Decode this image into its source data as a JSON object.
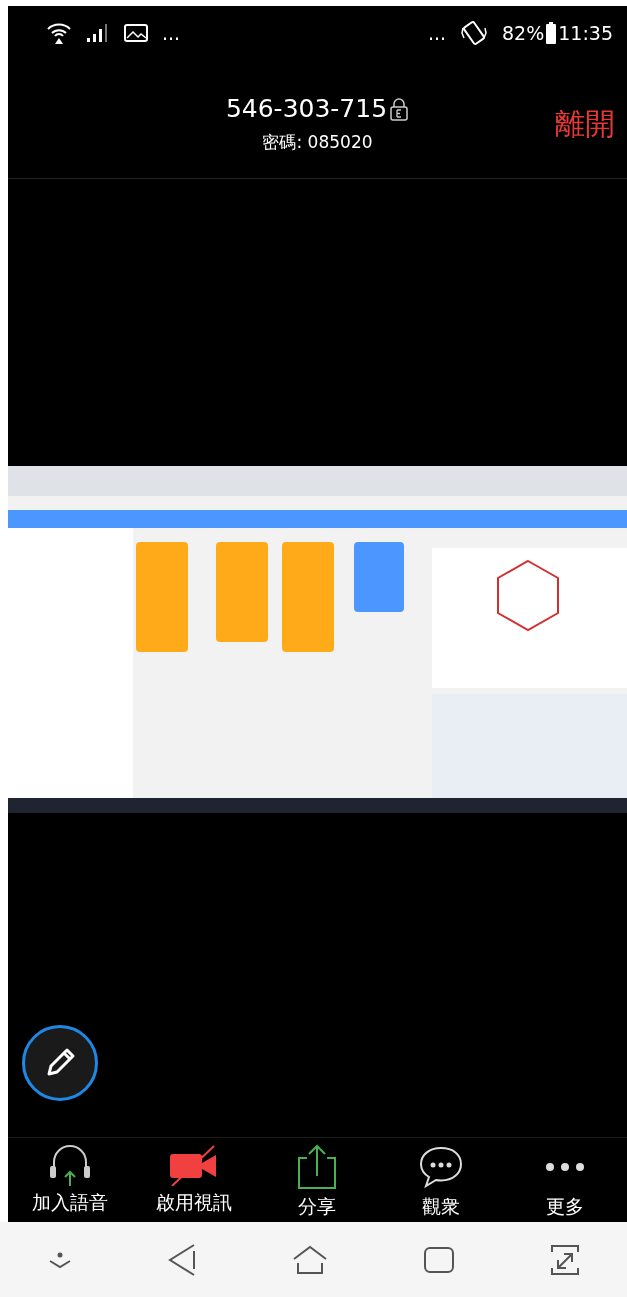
{
  "status_bar": {
    "left_more": "...",
    "right_more": "...",
    "battery": "82%",
    "time": "11:35"
  },
  "meeting": {
    "id": "546-303-715",
    "password": "密碼: 085020",
    "leave": "離開"
  },
  "toolbar": [
    {
      "kind": "audio",
      "label": "加入語音"
    },
    {
      "kind": "video",
      "label": "啟用視訊"
    },
    {
      "kind": "share",
      "label": "分享"
    },
    {
      "kind": "participants",
      "label": "觀衆"
    },
    {
      "kind": "more",
      "label": "更多"
    }
  ]
}
